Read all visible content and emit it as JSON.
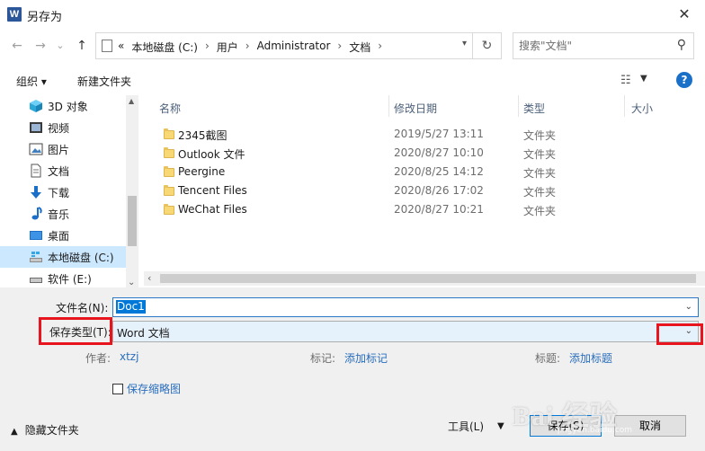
{
  "window": {
    "title": "另存为",
    "app_icon_letter": "W",
    "close_glyph": "✕"
  },
  "nav": {
    "back": "←",
    "forward": "→",
    "recent": "⌄",
    "up": "↑",
    "breadcrumb": {
      "overflow": "«",
      "drive": "本地磁盘 (C:)",
      "users": "用户",
      "user": "Administrator",
      "folder": "文档",
      "sep": "›"
    },
    "refresh": "↻",
    "search_placeholder": "搜索\"文档\""
  },
  "toolbar": {
    "organize": "组织 ▾",
    "new_folder": "新建文件夹",
    "help": "?"
  },
  "sidebar": {
    "items": [
      {
        "label": "3D 对象",
        "icon": "cube-icon"
      },
      {
        "label": "视频",
        "icon": "video-icon"
      },
      {
        "label": "图片",
        "icon": "picture-icon"
      },
      {
        "label": "文档",
        "icon": "document-icon"
      },
      {
        "label": "下载",
        "icon": "download-icon"
      },
      {
        "label": "音乐",
        "icon": "music-icon"
      },
      {
        "label": "桌面",
        "icon": "desktop-icon"
      },
      {
        "label": "本地磁盘 (C:)",
        "icon": "drive-icon",
        "selected": true
      },
      {
        "label": "软件 (E:)",
        "icon": "drive-icon"
      }
    ]
  },
  "filelist": {
    "columns": {
      "name": "名称",
      "date": "修改日期",
      "type": "类型",
      "size": "大小"
    },
    "rows": [
      {
        "name": "2345截图",
        "date": "2019/5/27 13:11",
        "type": "文件夹"
      },
      {
        "name": "Outlook 文件",
        "date": "2020/8/27 10:10",
        "type": "文件夹"
      },
      {
        "name": "Peergine",
        "date": "2020/8/25 14:12",
        "type": "文件夹"
      },
      {
        "name": "Tencent Files",
        "date": "2020/8/26 17:02",
        "type": "文件夹"
      },
      {
        "name": "WeChat Files",
        "date": "2020/8/27 10:21",
        "type": "文件夹"
      }
    ]
  },
  "form": {
    "filename_label": "文件名(N):",
    "filename_value": "Doc1",
    "filetype_label": "保存类型(T):",
    "filetype_value": "Word 文档",
    "author_label": "作者:",
    "author_value": "xtzj",
    "tags_label": "标记:",
    "tags_value": "添加标记",
    "title_label": "标题:",
    "title_value": "添加标题",
    "thumbnail_label": "保存缩略图"
  },
  "footer": {
    "hide_folders": "隐藏文件夹",
    "tools": "工具(L)",
    "save": "保存(S)",
    "cancel": "取消"
  },
  "watermark": {
    "text": "Bai 经验",
    "url": "jingyan.baidu.com"
  },
  "colors": {
    "accent": "#0078d7",
    "highlight": "#e8141e",
    "link": "#2a6ebc"
  }
}
